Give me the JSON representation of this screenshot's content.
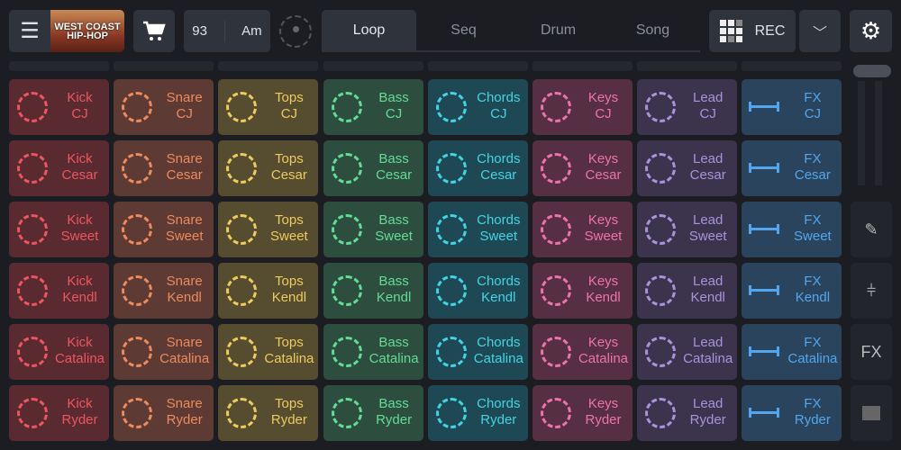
{
  "toolbar": {
    "cover_line1": "WEST COAST",
    "cover_line2": "HIP-HOP",
    "tempo": "93",
    "key": "Am",
    "rec_label": "REC",
    "tabs": [
      "Loop",
      "Seq",
      "Drum",
      "Song"
    ],
    "active_tab": "Loop"
  },
  "side": {
    "fx_label": "FX"
  },
  "columns": [
    {
      "name": "Kick",
      "bg": "#5a2a31",
      "fg": "#ee5560",
      "icon": "ring"
    },
    {
      "name": "Snare",
      "bg": "#5d3a33",
      "fg": "#ee8a5c",
      "icon": "ring"
    },
    {
      "name": "Tops",
      "bg": "#564c2f",
      "fg": "#eecb5e",
      "icon": "ring"
    },
    {
      "name": "Bass",
      "bg": "#2d4e3f",
      "fg": "#62dc94",
      "icon": "ring"
    },
    {
      "name": "Chords",
      "bg": "#1f4855",
      "fg": "#42d4e4",
      "icon": "ring"
    },
    {
      "name": "Keys",
      "bg": "#572f43",
      "fg": "#ee74a6",
      "icon": "ring"
    },
    {
      "name": "Lead",
      "bg": "#3c344d",
      "fg": "#ab92dc",
      "icon": "ring"
    },
    {
      "name": "FX",
      "bg": "#2a445e",
      "fg": "#52a6ee",
      "icon": "riser"
    }
  ],
  "rows": [
    "CJ",
    "Cesar",
    "Sweet",
    "Kendl",
    "Catalina",
    "Ryder"
  ]
}
